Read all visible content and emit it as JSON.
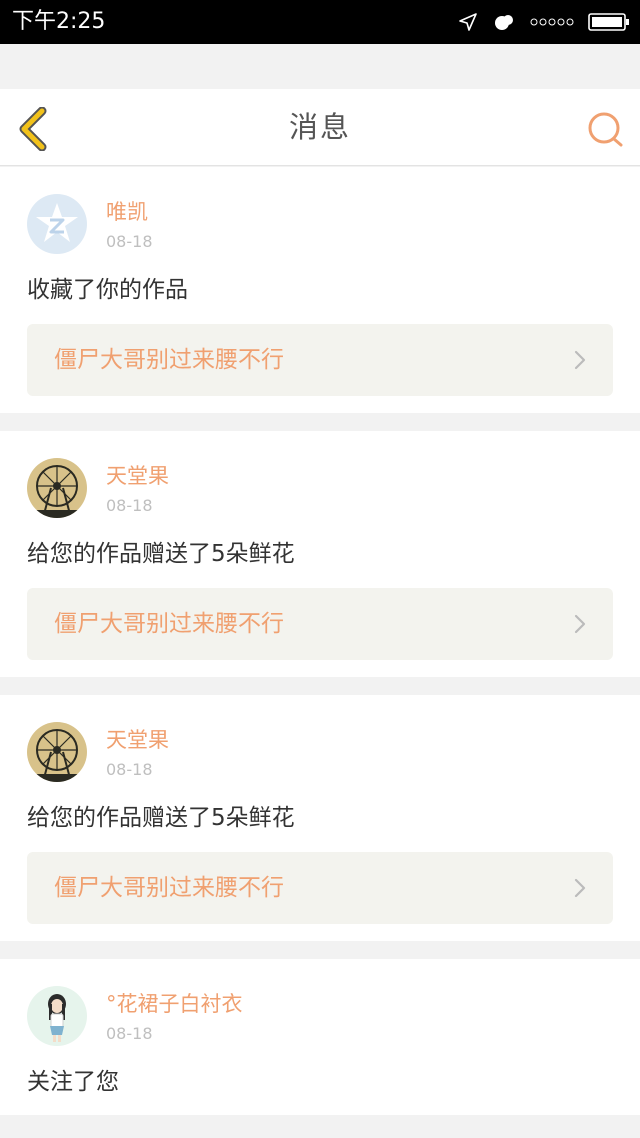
{
  "status": {
    "time": "下午2:25"
  },
  "header": {
    "title": "消息"
  },
  "messages": [
    {
      "user": "唯凯",
      "date": "08-18",
      "action": "收藏了你的作品",
      "work": "僵尸大哥别过来腰不行"
    },
    {
      "user": "天堂果",
      "date": "08-18",
      "action": "给您的作品赠送了5朵鲜花",
      "work": "僵尸大哥别过来腰不行"
    },
    {
      "user": "天堂果",
      "date": "08-18",
      "action": "给您的作品赠送了5朵鲜花",
      "work": "僵尸大哥别过来腰不行"
    },
    {
      "user": "°花裙子白衬衣",
      "date": "08-18",
      "action": "关注了您"
    }
  ],
  "icons": {
    "back": "chevron-left-icon",
    "search": "search-icon",
    "chevron": "chevron-right-icon"
  },
  "colors": {
    "accent": "#f0a070",
    "back_arrow": "#f2c21a",
    "link_bg": "#f3f3ee"
  }
}
